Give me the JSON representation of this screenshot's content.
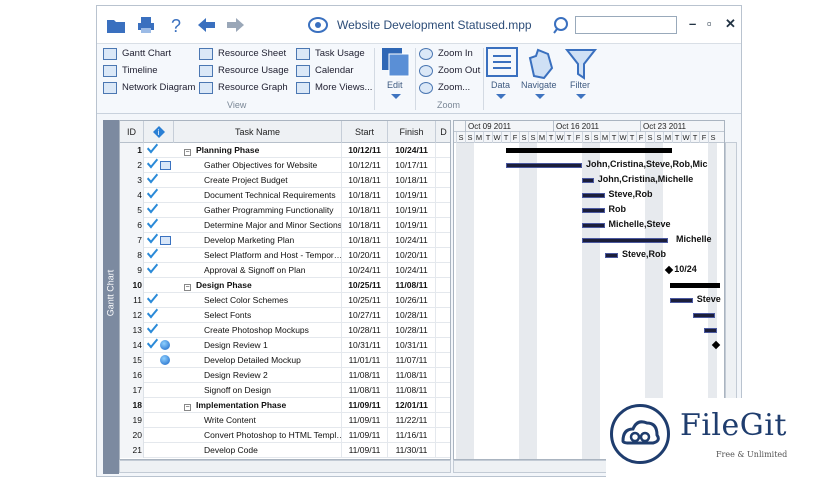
{
  "titlebar": {
    "title": "Website Development Statused.mpp",
    "icons": [
      "folder-icon",
      "print-icon",
      "help-icon",
      "back-arrow-icon",
      "forward-arrow-icon",
      "eye-icon",
      "search-icon"
    ],
    "window_buttons": [
      "–",
      "▫",
      "✕"
    ]
  },
  "ribbon": {
    "view_items": [
      [
        "Gantt Chart",
        "Resource Sheet",
        "Task Usage"
      ],
      [
        "Timeline",
        "Resource Usage",
        "Calendar"
      ],
      [
        "Network Diagram",
        "Resource Graph",
        "More Views..."
      ]
    ],
    "view_group": "View",
    "edit_label": "Edit",
    "zoom_items": [
      "Zoom In",
      "Zoom Out",
      "Zoom..."
    ],
    "zoom_group": "Zoom",
    "data_label": "Data",
    "navigate_label": "Navigate",
    "filter_label": "Filter"
  },
  "side_label": "Gantt Chart",
  "grid": {
    "headers": {
      "id": "ID",
      "indicator": "i",
      "name": "Task Name",
      "start": "Start",
      "finish": "Finish",
      "extra": "D"
    },
    "rows": [
      {
        "id": "1",
        "name": "Planning Phase",
        "start": "10/12/11",
        "finish": "10/24/11",
        "summary": true,
        "check": true,
        "extra": ""
      },
      {
        "id": "2",
        "name": "Gather Objectives for Website",
        "start": "10/12/11",
        "finish": "10/17/11",
        "summary": false,
        "check": true,
        "extra": "note"
      },
      {
        "id": "3",
        "name": "Create Project Budget",
        "start": "10/18/11",
        "finish": "10/18/11",
        "summary": false,
        "check": true,
        "extra": ""
      },
      {
        "id": "4",
        "name": "Document Technical Requirements",
        "start": "10/18/11",
        "finish": "10/19/11",
        "summary": false,
        "check": true,
        "extra": ""
      },
      {
        "id": "5",
        "name": "Gather Programming Functionality",
        "start": "10/18/11",
        "finish": "10/19/11",
        "summary": false,
        "check": true,
        "extra": ""
      },
      {
        "id": "6",
        "name": "Determine Major and Minor Sections",
        "start": "10/18/11",
        "finish": "10/19/11",
        "summary": false,
        "check": true,
        "extra": ""
      },
      {
        "id": "7",
        "name": "Develop Marketing Plan",
        "start": "10/18/11",
        "finish": "10/24/11",
        "summary": false,
        "check": true,
        "extra": "note"
      },
      {
        "id": "8",
        "name": "Select Platform and Host - Tempor…",
        "start": "10/20/11",
        "finish": "10/20/11",
        "summary": false,
        "check": true,
        "extra": ""
      },
      {
        "id": "9",
        "name": "Approval & Signoff on Plan",
        "start": "10/24/11",
        "finish": "10/24/11",
        "summary": false,
        "check": true,
        "extra": ""
      },
      {
        "id": "10",
        "name": "Design Phase",
        "start": "10/25/11",
        "finish": "11/08/11",
        "summary": true,
        "check": false,
        "extra": ""
      },
      {
        "id": "11",
        "name": "Select Color Schemes",
        "start": "10/25/11",
        "finish": "10/26/11",
        "summary": false,
        "check": true,
        "extra": ""
      },
      {
        "id": "12",
        "name": "Select Fonts",
        "start": "10/27/11",
        "finish": "10/28/11",
        "summary": false,
        "check": true,
        "extra": ""
      },
      {
        "id": "13",
        "name": "Create Photoshop Mockups",
        "start": "10/28/11",
        "finish": "10/28/11",
        "summary": false,
        "check": true,
        "extra": ""
      },
      {
        "id": "14",
        "name": "Design Review 1",
        "start": "10/31/11",
        "finish": "10/31/11",
        "summary": false,
        "check": true,
        "extra": "globe"
      },
      {
        "id": "15",
        "name": "Develop Detailed Mockup",
        "start": "11/01/11",
        "finish": "11/07/11",
        "summary": false,
        "check": false,
        "extra": "globe"
      },
      {
        "id": "16",
        "name": "Design Review 2",
        "start": "11/08/11",
        "finish": "11/08/11",
        "summary": false,
        "check": false,
        "extra": ""
      },
      {
        "id": "17",
        "name": "Signoff on Design",
        "start": "11/08/11",
        "finish": "11/08/11",
        "summary": false,
        "check": false,
        "extra": ""
      },
      {
        "id": "18",
        "name": "Implementation Phase",
        "start": "11/09/11",
        "finish": "12/01/11",
        "summary": true,
        "check": false,
        "extra": ""
      },
      {
        "id": "19",
        "name": "Write Content",
        "start": "11/09/11",
        "finish": "11/22/11",
        "summary": false,
        "check": false,
        "extra": ""
      },
      {
        "id": "20",
        "name": "Convert Photoshop to HTML Templ…",
        "start": "11/09/11",
        "finish": "11/16/11",
        "summary": false,
        "check": false,
        "extra": ""
      },
      {
        "id": "21",
        "name": "Develop Code",
        "start": "11/09/11",
        "finish": "11/30/11",
        "summary": false,
        "check": false,
        "extra": ""
      }
    ]
  },
  "gantt": {
    "weeks": [
      "Oct 09 2011",
      "Oct 16 2011",
      "Oct 23 2011"
    ],
    "days": [
      "S",
      "S",
      "M",
      "T",
      "W",
      "T",
      "F",
      "S",
      "S",
      "M",
      "T",
      "W",
      "T",
      "F",
      "S",
      "S",
      "M",
      "T",
      "W",
      "T",
      "F",
      "S",
      "S",
      "M",
      "T",
      "W",
      "T",
      "F",
      "S"
    ],
    "labels": {
      "r2": "John,Cristina,Steve,Rob,Mic",
      "r3": "John,Cristina,Michelle",
      "r4": "Steve,Rob",
      "r5": "Rob",
      "r6": "Michelle,Steve",
      "r7": "Michelle",
      "r8": "Steve,Rob",
      "r9": "10/24",
      "r11": "Steve"
    }
  },
  "logo": {
    "name": "FileGit",
    "tagline": "Free & Unlimited"
  }
}
